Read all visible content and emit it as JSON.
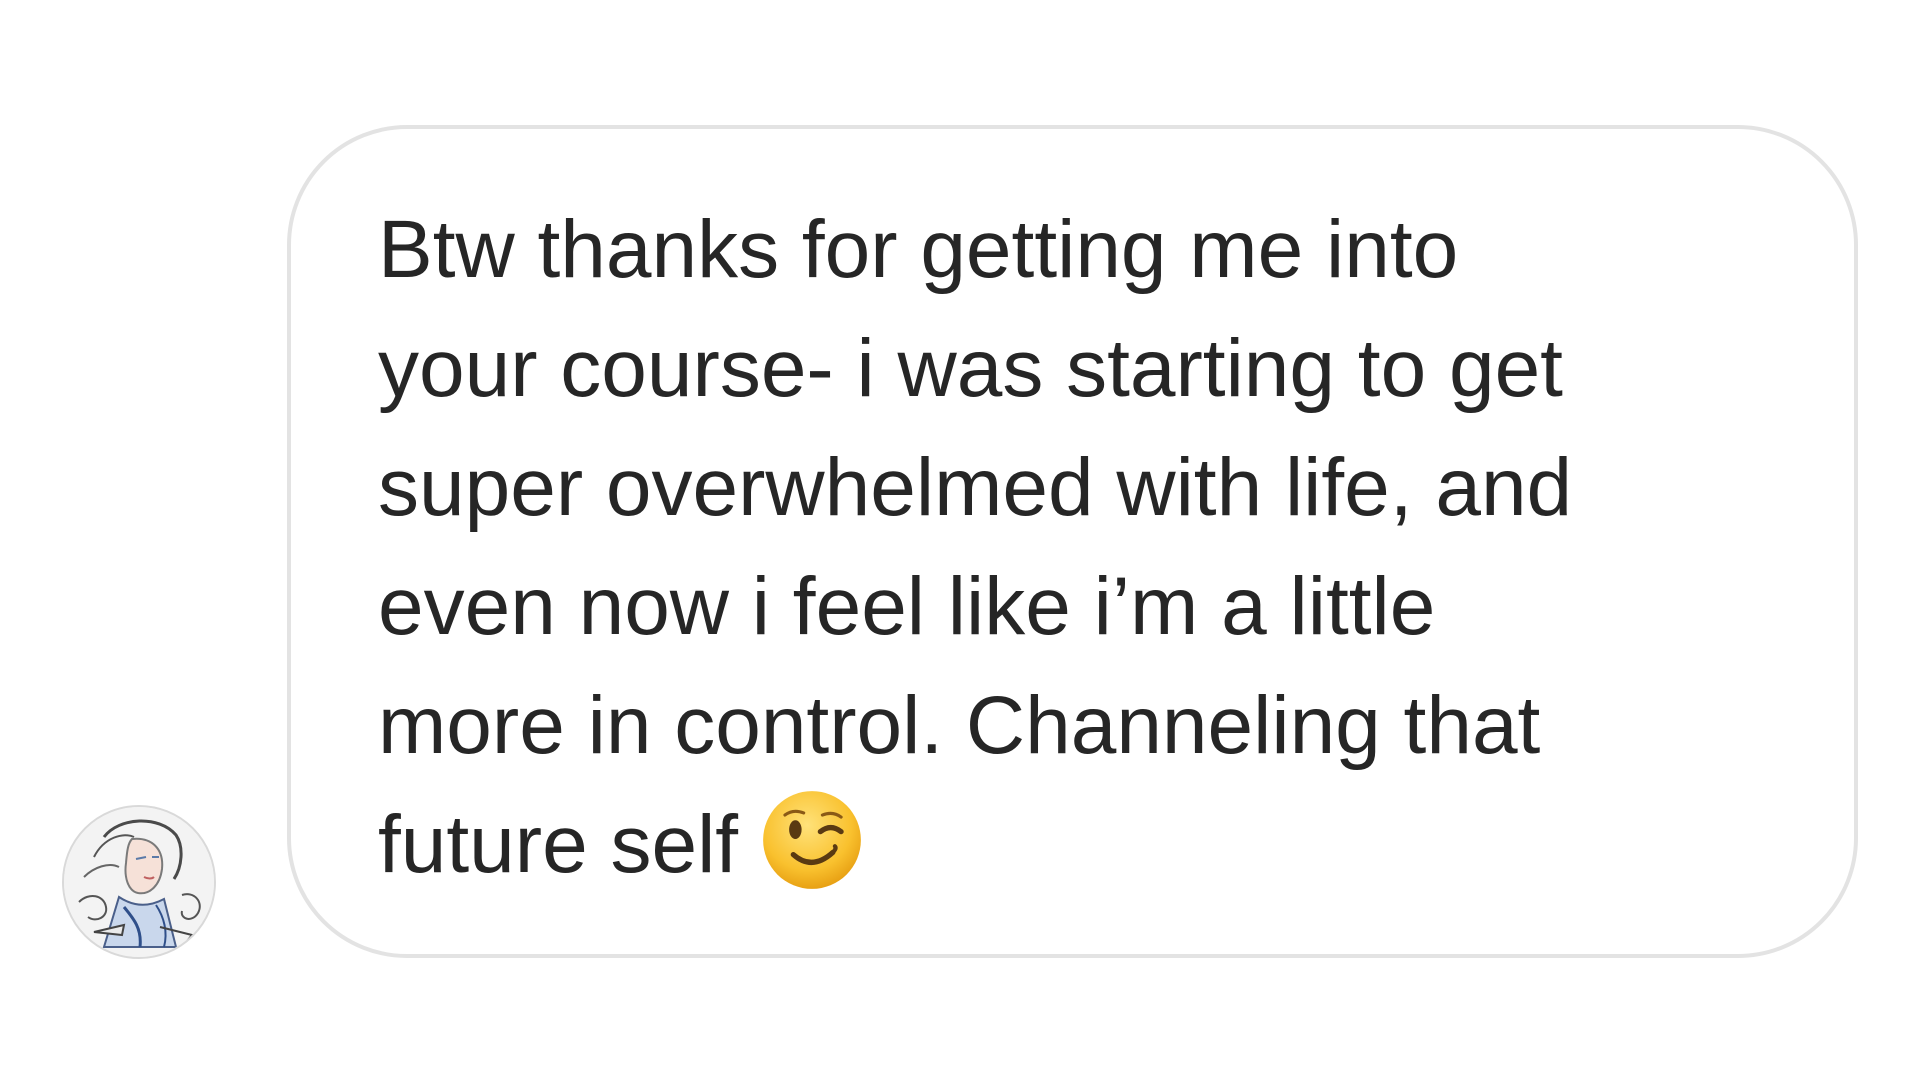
{
  "conversation": {
    "sender": {
      "avatar_icon": "illustrated-portrait-avatar"
    },
    "message": {
      "lines": [
        "Btw thanks for getting me into",
        "your course- i was starting to get",
        "super overwhelmed with life, and",
        "even now i feel like i’m a little",
        "more in control. Channeling that",
        "future self"
      ],
      "emoji_icon": "winking-face-emoji"
    }
  },
  "colors": {
    "background": "#ffffff",
    "bubble_border": "#e3e3e3",
    "text": "#262626",
    "emoji_face": "#f9c12e"
  }
}
